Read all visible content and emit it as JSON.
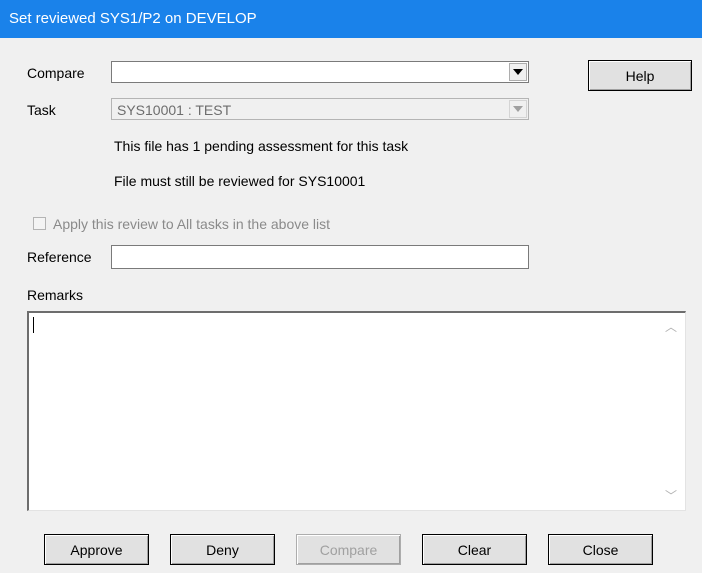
{
  "window": {
    "title": "Set reviewed SYS1/P2 on DEVELOP"
  },
  "compare": {
    "label": "Compare",
    "value": ""
  },
  "help_button": "Help",
  "task": {
    "label": "Task",
    "value": "SYS10001 : TEST"
  },
  "info": {
    "pending": "This file has 1 pending assessment for this task",
    "review_needed": "File must still be reviewed for SYS10001"
  },
  "apply_all": {
    "label": "Apply this review to All tasks in the above list",
    "checked": false
  },
  "reference": {
    "label": "Reference",
    "value": ""
  },
  "remarks": {
    "label": "Remarks",
    "value": ""
  },
  "buttons": {
    "approve": "Approve",
    "deny": "Deny",
    "compare": "Compare",
    "clear": "Clear",
    "close": "Close"
  }
}
